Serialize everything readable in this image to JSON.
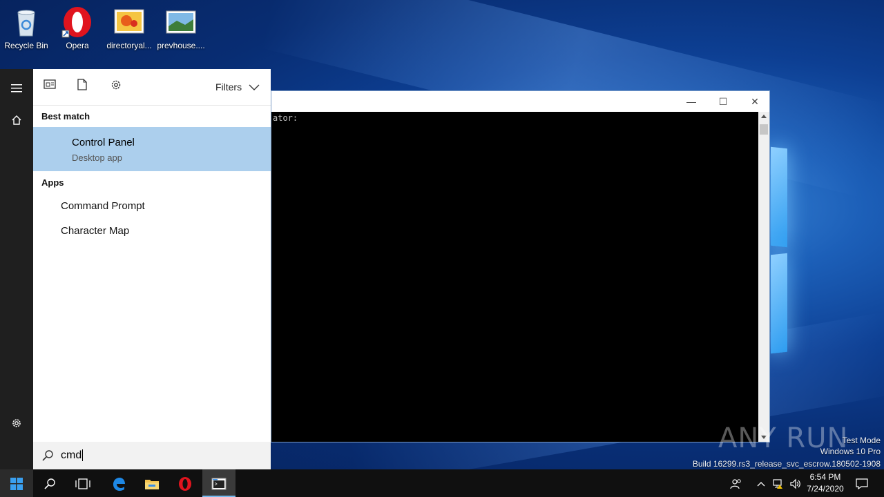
{
  "desktop": {
    "icons": [
      {
        "label": "Recycle Bin"
      },
      {
        "label": "Opera"
      },
      {
        "label": "directoryal..."
      },
      {
        "label": "prevhouse...."
      }
    ]
  },
  "cmd_window": {
    "console_text": "ator:",
    "buttons": {
      "minimize": "—",
      "maximize": "☐",
      "close": "✕"
    }
  },
  "start_menu": {
    "toolbar": {
      "filters_label": "Filters"
    },
    "best_match_heading": "Best match",
    "best_match": {
      "title": "Control Panel",
      "subtitle": "Desktop app"
    },
    "apps_heading": "Apps",
    "apps": [
      {
        "label": "Command Prompt"
      },
      {
        "label": "Character Map"
      }
    ],
    "search": {
      "value": "cmd"
    }
  },
  "watermark": {
    "brand": "ANY RUN",
    "line1": "Test Mode",
    "line2": "Windows 10 Pro",
    "line3": "Build 16299.rs3_release_svc_escrow.180502-1908"
  },
  "tray": {
    "time": "6:54 PM",
    "date": "7/24/2020"
  },
  "colors": {
    "selected_item": "#accfed",
    "rail": "#1f1f1f",
    "taskbar": "#101010",
    "accent": "#0078d7"
  }
}
